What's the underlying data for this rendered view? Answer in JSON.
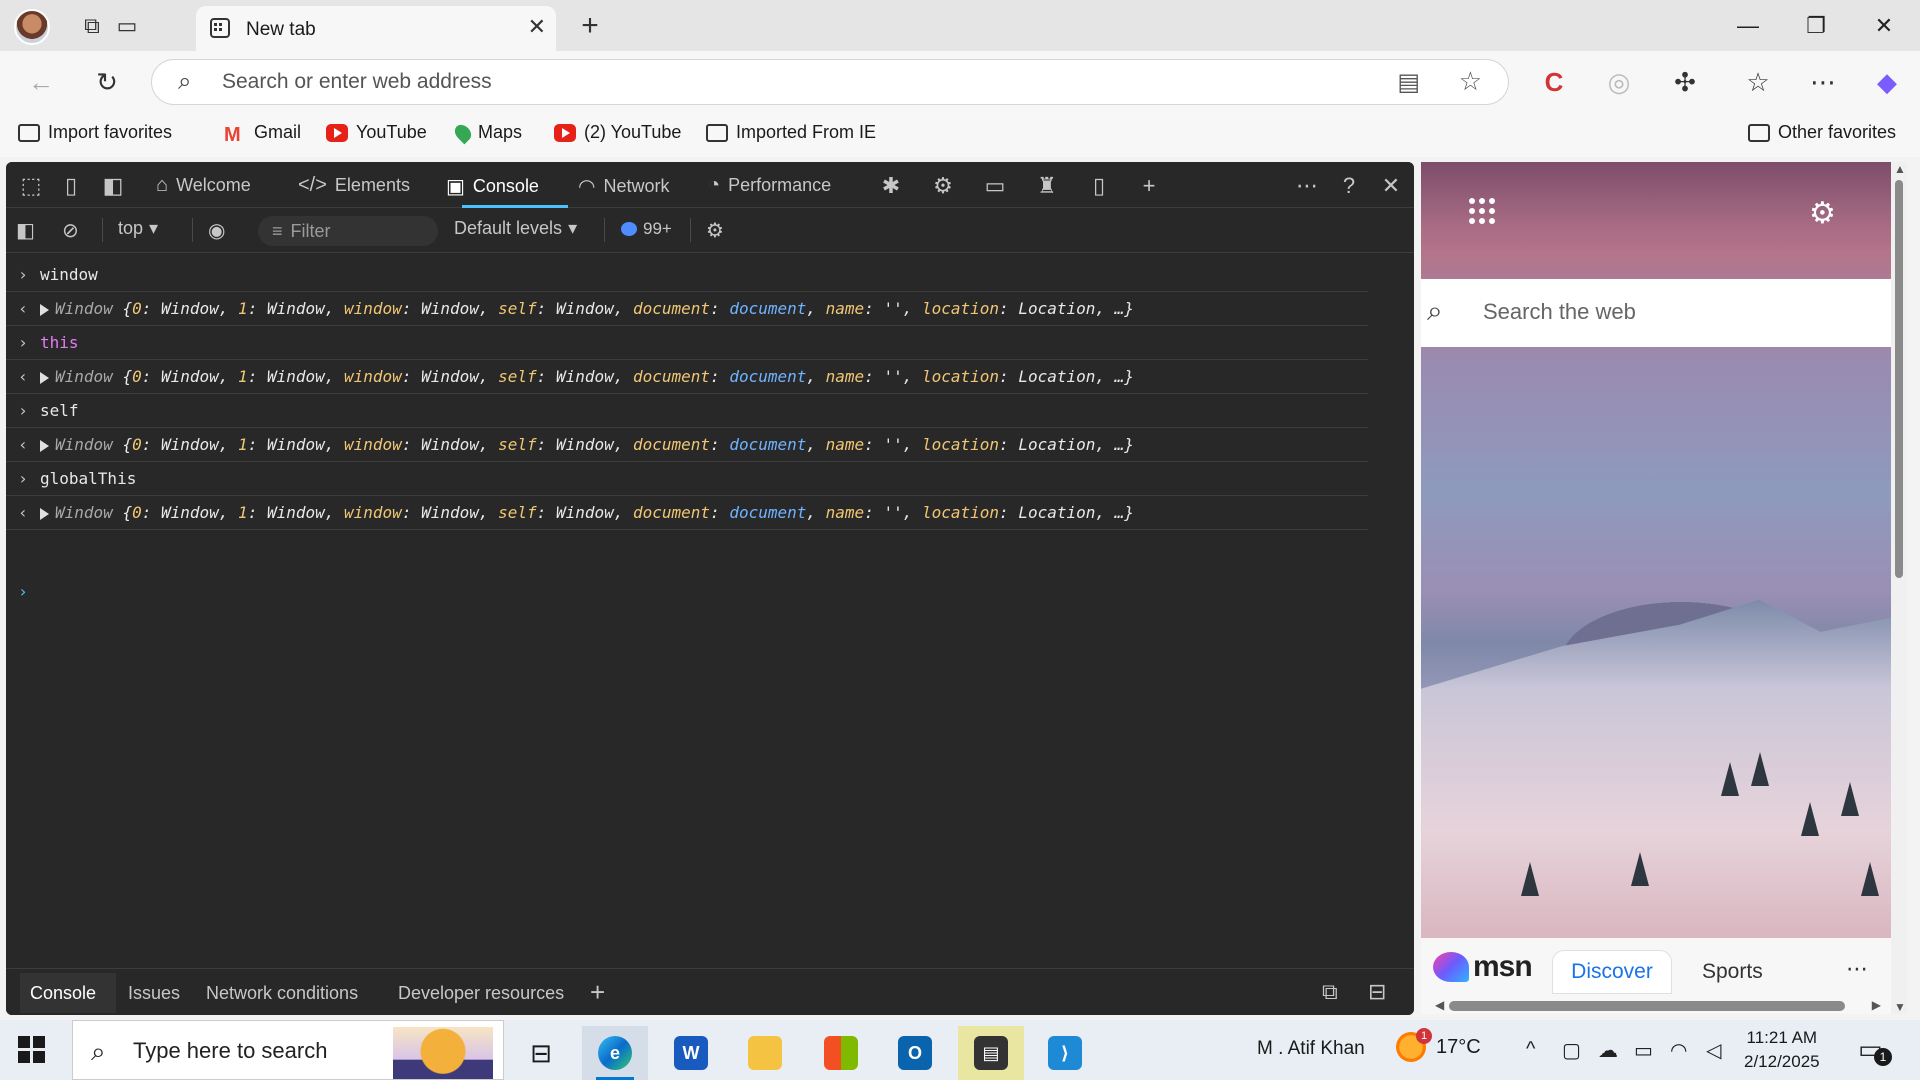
{
  "browser": {
    "tab_title": "New tab",
    "address_placeholder": "Search or enter web address",
    "bookmarks": [
      {
        "label": "Import favorites",
        "icon": "import-icon"
      },
      {
        "label": "Gmail",
        "icon": "gmail-icon"
      },
      {
        "label": "YouTube",
        "icon": "youtube-icon"
      },
      {
        "label": "Maps",
        "icon": "maps-icon"
      },
      {
        "label": "(2) YouTube",
        "icon": "youtube-icon"
      },
      {
        "label": "Imported From IE",
        "icon": "folder-icon"
      }
    ],
    "other_favorites": "Other favorites"
  },
  "devtools": {
    "tabs": [
      {
        "label": "Welcome",
        "icon": "home-icon"
      },
      {
        "label": "Elements",
        "icon": "code-icon"
      },
      {
        "label": "Console",
        "icon": "console-icon",
        "active": true
      },
      {
        "label": "Network",
        "icon": "wifi-icon"
      },
      {
        "label": "Performance",
        "icon": "gauge-icon"
      }
    ],
    "toolbar": {
      "context": "top",
      "filter_placeholder": "Filter",
      "levels": "Default levels",
      "message_count": "99+"
    },
    "console_entries": [
      {
        "input": "window",
        "kw": false
      },
      {
        "input": "this",
        "kw": true
      },
      {
        "input": "self",
        "kw": false
      },
      {
        "input": "globalThis",
        "kw": false
      }
    ],
    "output_line": {
      "prefix": "Window ",
      "open": "{",
      "p0k": "0",
      "p0v": "Window",
      "p1k": "1",
      "p1v": "Window",
      "p2k": "window",
      "p2v": "Window",
      "p3k": "self",
      "p3v": "Window",
      "p4k": "document",
      "p4v": "document",
      "p5k": "name",
      "p5v": "''",
      "p6k": "location",
      "p6v": "Location",
      "tail": "…}"
    },
    "drawer_tabs": [
      "Console",
      "Issues",
      "Network conditions",
      "Developer resources"
    ]
  },
  "msn": {
    "search_placeholder": "Search the web",
    "logo": "msn",
    "tabs": [
      "Discover",
      "Sports"
    ]
  },
  "taskbar": {
    "search_text": "Type here to search",
    "user": "M . Atif Khan",
    "temperature": "17°C",
    "weather_badge": "1",
    "time": "11:21 AM",
    "date": "2/12/2025",
    "notification_count": "1"
  },
  "colors": {
    "accent": "#4cc2ff",
    "devtools_bg": "#282828",
    "keyword": "#e47cf4",
    "object_key": "#f0c674",
    "link": "#6fb3ff"
  }
}
